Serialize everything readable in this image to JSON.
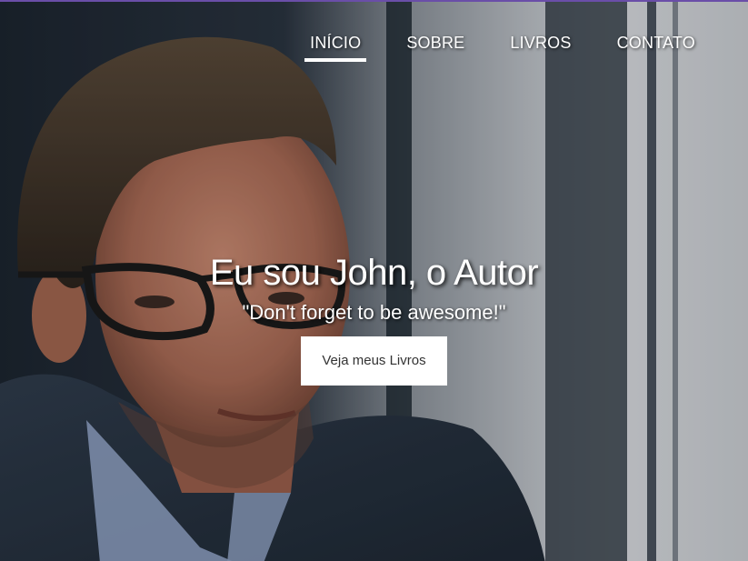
{
  "nav": {
    "items": [
      {
        "label": "INÍCIO",
        "active": true
      },
      {
        "label": "SOBRE",
        "active": false
      },
      {
        "label": "LIVROS",
        "active": false
      },
      {
        "label": "CONTATO",
        "active": false
      }
    ]
  },
  "hero": {
    "title": "Eu sou John, o Autor",
    "subtitle": "\"Don't forget to be awesome!\"",
    "button_label": "Veja meus Livros"
  },
  "colors": {
    "top_border": "#6a4ea8",
    "nav_text": "#ffffff",
    "button_bg": "#ffffff",
    "button_text": "#333333"
  }
}
